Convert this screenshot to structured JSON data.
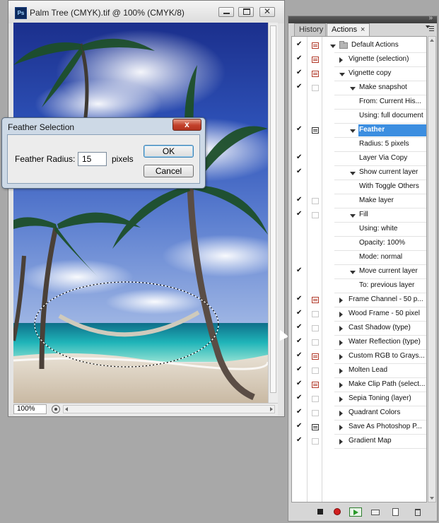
{
  "document": {
    "title": "Palm Tree (CMYK).tif @ 100% (CMYK/8)",
    "app_icon": "Ps",
    "zoom": "100%"
  },
  "dialog": {
    "title": "Feather Selection",
    "close_glyph": "x",
    "radius_label": "Feather Radius:",
    "radius_value": "15",
    "unit": "pixels",
    "ok_label": "OK",
    "cancel_label": "Cancel"
  },
  "panel": {
    "tabs": [
      {
        "label": "History"
      },
      {
        "label": "Actions"
      }
    ],
    "tab_close_glyph": "×",
    "rows": [
      {
        "label": "Default Actions",
        "check": true,
        "dialog": "red",
        "indent": 0,
        "expander": "down",
        "folder": true,
        "selected": false
      },
      {
        "label": "Vignette (selection)",
        "check": true,
        "dialog": "red",
        "indent": 1,
        "expander": "right",
        "folder": false,
        "selected": false
      },
      {
        "label": "Vignette copy",
        "check": true,
        "dialog": "red",
        "indent": 1,
        "expander": "down",
        "folder": false,
        "selected": false
      },
      {
        "label": "Make snapshot",
        "check": true,
        "dialog": "empty",
        "indent": 2,
        "expander": "down",
        "folder": false,
        "selected": false
      },
      {
        "label": "From: Current His...",
        "check": false,
        "dialog": "none",
        "indent": 3,
        "expander": "none",
        "folder": false,
        "selected": false
      },
      {
        "label": "Using: full document",
        "check": false,
        "dialog": "none",
        "indent": 3,
        "expander": "none",
        "folder": false,
        "selected": false
      },
      {
        "label": "Feather",
        "check": true,
        "dialog": "dark",
        "indent": 2,
        "expander": "down",
        "folder": false,
        "selected": true
      },
      {
        "label": "Radius: 5 pixels",
        "check": false,
        "dialog": "none",
        "indent": 3,
        "expander": "none",
        "folder": false,
        "selected": false
      },
      {
        "label": "Layer Via Copy",
        "check": true,
        "dialog": "none",
        "indent": 2,
        "expander": "none",
        "folder": false,
        "selected": false
      },
      {
        "label": "Show current layer",
        "check": true,
        "dialog": "none",
        "indent": 2,
        "expander": "down",
        "folder": false,
        "selected": false
      },
      {
        "label": "With Toggle Others",
        "check": false,
        "dialog": "none",
        "indent": 3,
        "expander": "none",
        "folder": false,
        "selected": false
      },
      {
        "label": "Make layer",
        "check": true,
        "dialog": "empty",
        "indent": 2,
        "expander": "none",
        "folder": false,
        "selected": false
      },
      {
        "label": "Fill",
        "check": true,
        "dialog": "empty",
        "indent": 2,
        "expander": "down",
        "folder": false,
        "selected": false
      },
      {
        "label": "Using: white",
        "check": false,
        "dialog": "none",
        "indent": 3,
        "expander": "none",
        "folder": false,
        "selected": false
      },
      {
        "label": "Opacity: 100%",
        "check": false,
        "dialog": "none",
        "indent": 3,
        "expander": "none",
        "folder": false,
        "selected": false
      },
      {
        "label": "Mode: normal",
        "check": false,
        "dialog": "none",
        "indent": 3,
        "expander": "none",
        "folder": false,
        "selected": false
      },
      {
        "label": "Move current layer",
        "check": true,
        "dialog": "none",
        "indent": 2,
        "expander": "down",
        "folder": false,
        "selected": false
      },
      {
        "label": "To: previous layer",
        "check": false,
        "dialog": "none",
        "indent": 3,
        "expander": "none",
        "folder": false,
        "selected": false
      },
      {
        "label": "Frame Channel - 50 p...",
        "check": true,
        "dialog": "red",
        "indent": 1,
        "expander": "right",
        "folder": false,
        "selected": false
      },
      {
        "label": "Wood Frame - 50 pixel",
        "check": true,
        "dialog": "empty",
        "indent": 1,
        "expander": "right",
        "folder": false,
        "selected": false
      },
      {
        "label": "Cast Shadow (type)",
        "check": true,
        "dialog": "empty",
        "indent": 1,
        "expander": "right",
        "folder": false,
        "selected": false
      },
      {
        "label": "Water Reflection (type)",
        "check": true,
        "dialog": "empty",
        "indent": 1,
        "expander": "right",
        "folder": false,
        "selected": false
      },
      {
        "label": "Custom RGB to Grays...",
        "check": true,
        "dialog": "red",
        "indent": 1,
        "expander": "right",
        "folder": false,
        "selected": false
      },
      {
        "label": "Molten Lead",
        "check": true,
        "dialog": "empty",
        "indent": 1,
        "expander": "right",
        "folder": false,
        "selected": false
      },
      {
        "label": "Make Clip Path (select...",
        "check": true,
        "dialog": "red",
        "indent": 1,
        "expander": "right",
        "folder": false,
        "selected": false
      },
      {
        "label": "Sepia Toning (layer)",
        "check": true,
        "dialog": "empty",
        "indent": 1,
        "expander": "right",
        "folder": false,
        "selected": false
      },
      {
        "label": "Quadrant Colors",
        "check": true,
        "dialog": "empty",
        "indent": 1,
        "expander": "right",
        "folder": false,
        "selected": false
      },
      {
        "label": "Save As Photoshop P...",
        "check": true,
        "dialog": "dark",
        "indent": 1,
        "expander": "right",
        "folder": false,
        "selected": false
      },
      {
        "label": "Gradient Map",
        "check": true,
        "dialog": "empty",
        "indent": 1,
        "expander": "right",
        "folder": false,
        "selected": false
      }
    ]
  },
  "toolbar": {
    "buttons": [
      "stop-icon",
      "record-icon",
      "play-icon",
      "new-set-icon",
      "new-action-icon",
      "trash-icon"
    ]
  },
  "colors": {
    "selection_highlight": "#3c8ee0",
    "dialog_frame": "#cdd9e6",
    "record_red": "#d21f1f"
  }
}
